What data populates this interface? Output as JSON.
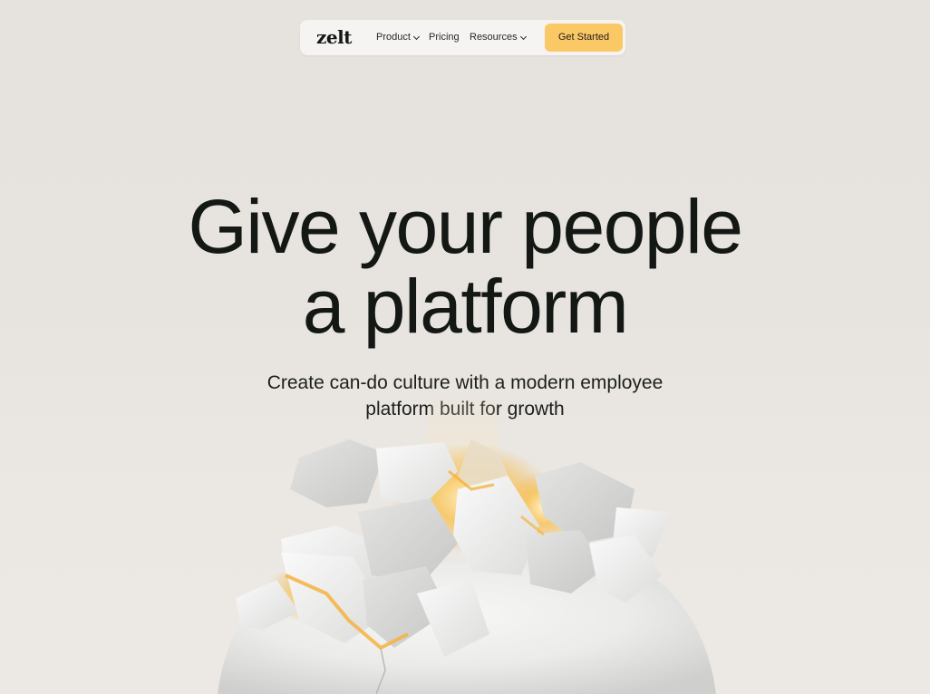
{
  "nav": {
    "logo": "zelt",
    "links": [
      {
        "label": "Product",
        "has_dropdown": true
      },
      {
        "label": "Pricing",
        "has_dropdown": false
      },
      {
        "label": "Resources",
        "has_dropdown": true
      }
    ],
    "cta_label": "Get Started"
  },
  "hero": {
    "title_lines": [
      "Give your people",
      "a platform"
    ],
    "subtitle_lines": [
      "Create can-do culture with a modern employee",
      "platform built for growth"
    ]
  },
  "colors": {
    "background": "#e7e3df",
    "nav_background": "#f5f4f2",
    "cta_background": "#fbc866",
    "text": "#141814",
    "glow": "#f4b33f"
  },
  "icons": [
    "chevron-down-icon",
    "cracked-egg-illustration"
  ]
}
